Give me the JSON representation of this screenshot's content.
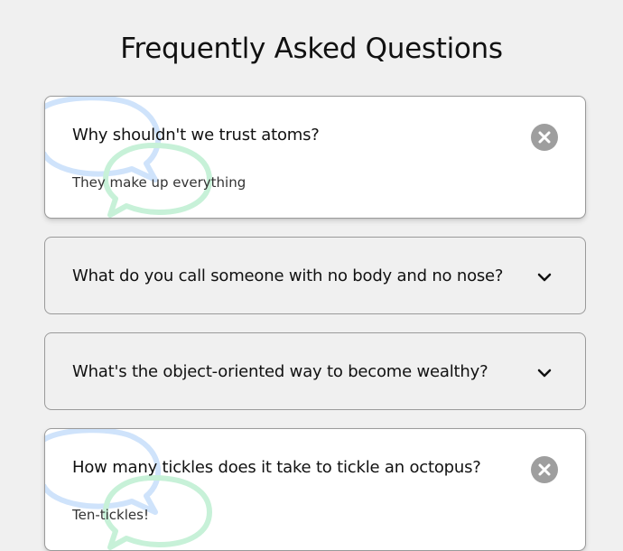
{
  "page": {
    "title": "Frequently Asked Questions"
  },
  "faqs": [
    {
      "question": "Why shouldn't we trust atoms?",
      "answer": "They make up everything",
      "expanded": true
    },
    {
      "question": "What do you call someone with no body and no nose?",
      "answer": "",
      "expanded": false
    },
    {
      "question": "What's the object-oriented way to become wealthy?",
      "answer": "",
      "expanded": false
    },
    {
      "question": "How many tickles does it take to tickle an octopus?",
      "answer": "Ten-tickles!",
      "expanded": true
    }
  ],
  "icons": {
    "close": "close-icon",
    "expand": "chevron-down-icon",
    "decoration": "speech-bubbles-icon"
  },
  "colors": {
    "background": "#f0f0f0",
    "card_active": "#ffffff",
    "border": "#9a9a9a",
    "close_button": "#9e9e9e",
    "bubble_blue": "#cfe3fb",
    "bubble_green": "#c7f1d8"
  }
}
